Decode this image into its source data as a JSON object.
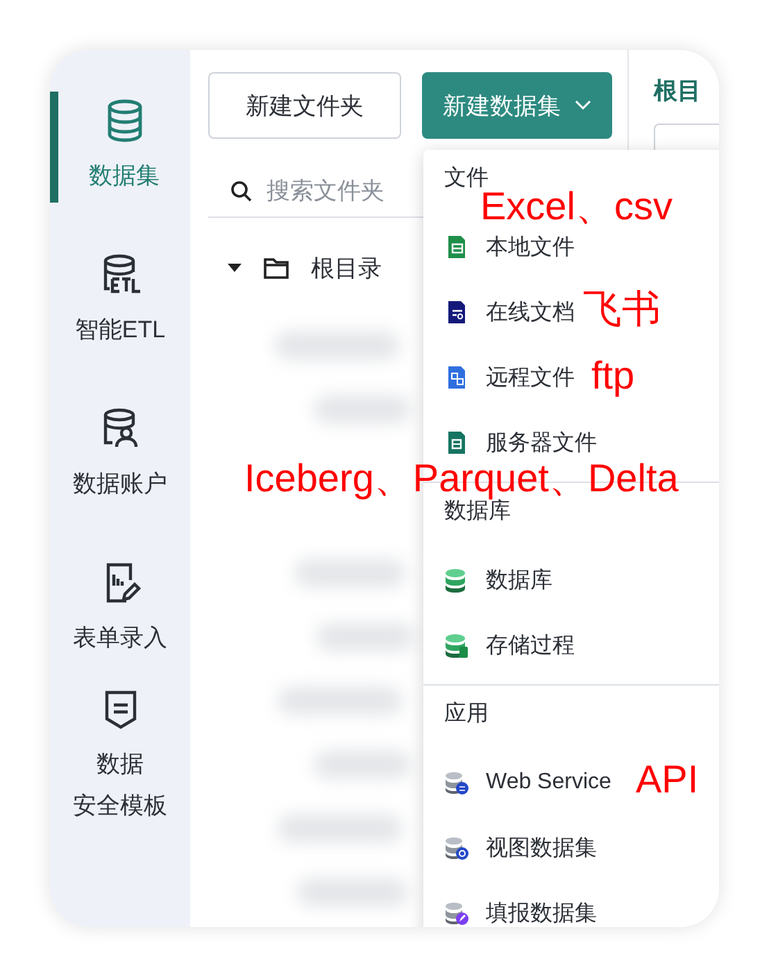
{
  "sidebar": {
    "items": [
      {
        "lines": [
          "数据集"
        ],
        "selected": true
      },
      {
        "lines": [
          "智能ETL"
        ],
        "selected": false
      },
      {
        "lines": [
          "数据账户"
        ],
        "selected": false
      },
      {
        "lines": [
          "表单录入"
        ],
        "selected": false
      },
      {
        "lines": [
          "数据",
          "安全模板"
        ],
        "selected": false
      }
    ]
  },
  "toolbar": {
    "new_folder": "新建文件夹",
    "new_dataset": "新建数据集"
  },
  "search": {
    "placeholder": "搜索文件夹"
  },
  "tree": {
    "label": "根目录",
    "expanded": true
  },
  "right_panel": {
    "title": "根目"
  },
  "dropdown": {
    "groups": [
      {
        "title": "文件",
        "items": [
          "本地文件",
          "在线文档",
          "远程文件",
          "服务器文件"
        ]
      },
      {
        "title": "数据库",
        "items": [
          "数据库",
          "存储过程"
        ]
      },
      {
        "title": "应用",
        "items": [
          "Web Service",
          "视图数据集",
          "填报数据集"
        ]
      }
    ]
  },
  "annotations": [
    "Excel、csv",
    "飞书",
    "ftp",
    "Iceberg、Parquet、Delta",
    "API"
  ]
}
